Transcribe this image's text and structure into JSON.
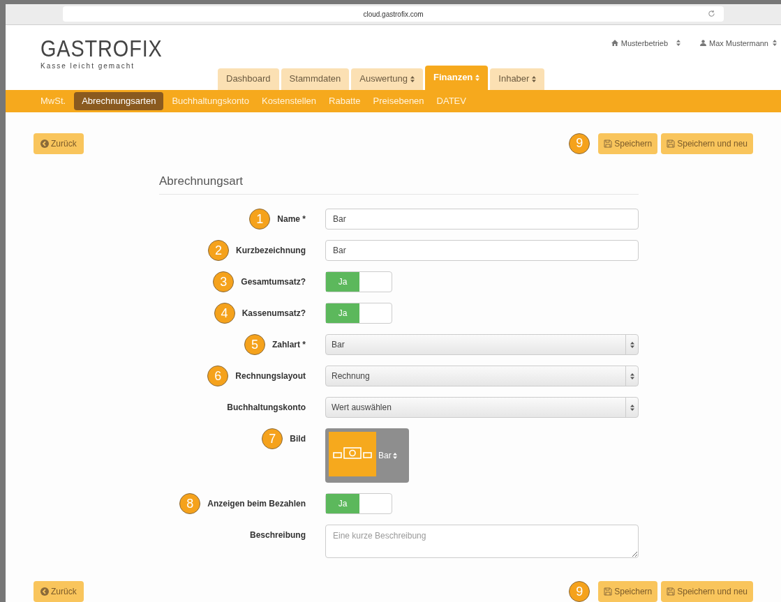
{
  "browser": {
    "url": "cloud.gastrofix.com"
  },
  "header": {
    "logo": "GASTROFIX",
    "tagline": "Kasse leicht gemacht",
    "business": "Musterbetrieb",
    "user": "Max Mustermann"
  },
  "main_tabs": [
    {
      "label": "Dashboard",
      "selected": false,
      "dropdown": false
    },
    {
      "label": "Stammdaten",
      "selected": false,
      "dropdown": false
    },
    {
      "label": "Auswertung",
      "selected": false,
      "dropdown": true
    },
    {
      "label": "Finanzen",
      "selected": true,
      "dropdown": true
    },
    {
      "label": "Inhaber",
      "selected": false,
      "dropdown": true
    }
  ],
  "sub_tabs": [
    {
      "label": "MwSt.",
      "selected": false
    },
    {
      "label": "Abrechnungsarten",
      "selected": true
    },
    {
      "label": "Buchhaltungskonto",
      "selected": false
    },
    {
      "label": "Kostenstellen",
      "selected": false
    },
    {
      "label": "Rabatte",
      "selected": false
    },
    {
      "label": "Preisebenen",
      "selected": false
    },
    {
      "label": "DATEV",
      "selected": false
    }
  ],
  "top_toolbar": {
    "back": "Zurück",
    "marker": "9",
    "save": "Speichern",
    "save_new": "Speichern und neu"
  },
  "form": {
    "title": "Abrechnungsart",
    "fields": [
      {
        "kind": "text",
        "marker": "1",
        "label": "Name *",
        "value": "Bar"
      },
      {
        "kind": "text",
        "marker": "2",
        "label": "Kurzbezeichnung",
        "value": "Bar"
      },
      {
        "kind": "toggle",
        "marker": "3",
        "label": "Gesamtumsatz?",
        "on": true,
        "state_label": "Ja"
      },
      {
        "kind": "toggle",
        "marker": "4",
        "label": "Kassenumsatz?",
        "on": true,
        "state_label": "Ja"
      },
      {
        "kind": "select",
        "marker": "5",
        "label": "Zahlart *",
        "value": "Bar"
      },
      {
        "kind": "select",
        "marker": "6",
        "label": "Rechnungslayout",
        "value": "Rechnung"
      },
      {
        "kind": "select",
        "label": "Buchhaltungskonto",
        "value": "Wert auswählen"
      },
      {
        "kind": "image",
        "marker": "7",
        "label": "Bild",
        "value": "Bar"
      },
      {
        "kind": "toggle",
        "marker": "8",
        "label": "Anzeigen beim Bezahlen",
        "on": true,
        "state_label": "Ja"
      },
      {
        "kind": "textarea",
        "label": "Beschreibung",
        "placeholder": "Eine kurze Beschreibung"
      }
    ]
  },
  "bottom_toolbar": {
    "back": "Zurück",
    "marker": "9",
    "save": "Speichern",
    "save_new": "Speichern und neu"
  }
}
